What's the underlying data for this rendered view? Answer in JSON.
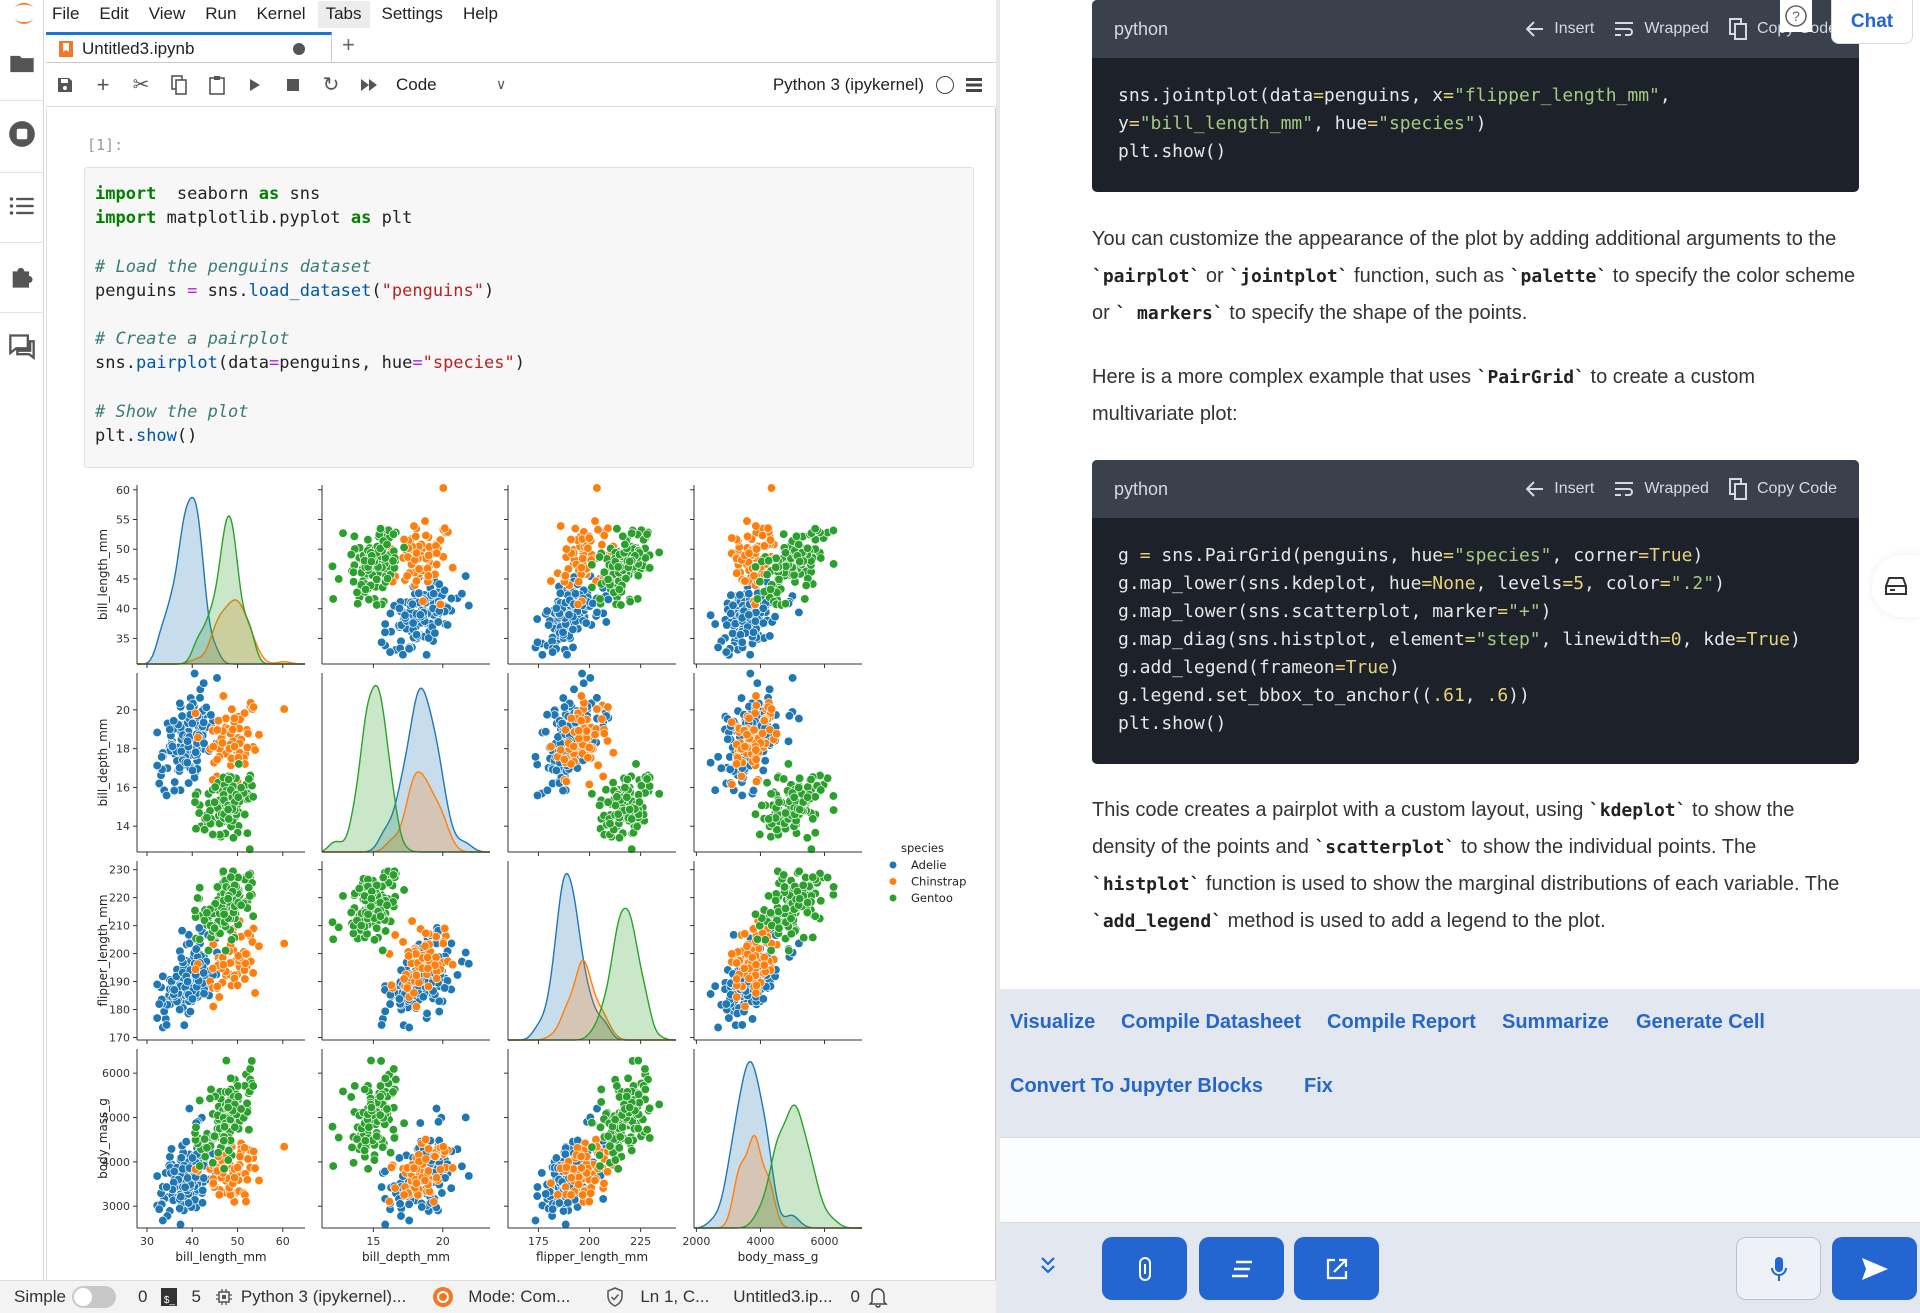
{
  "menu": [
    "File",
    "Edit",
    "View",
    "Run",
    "Kernel",
    "Tabs",
    "Settings",
    "Help"
  ],
  "menu_active": "Tabs",
  "tab": {
    "title": "Untitled3.ipynb",
    "new_tab": "+"
  },
  "toolbar": {
    "cell_type": "Code",
    "kernel": "Python 3 (ipykernel)"
  },
  "cell": {
    "prompt": "[1]:",
    "lines": [
      [
        [
          "kw",
          "import"
        ],
        [
          "",
          "  seaborn "
        ],
        [
          "kw",
          "as"
        ],
        [
          "",
          " sns"
        ]
      ],
      [
        [
          "kw",
          "import"
        ],
        [
          "",
          " matplotlib.pyplot "
        ],
        [
          "kw",
          "as"
        ],
        [
          "",
          " plt"
        ]
      ],
      [],
      [
        [
          "cm",
          "# Load the penguins dataset"
        ]
      ],
      [
        [
          "",
          "penguins "
        ],
        [
          "op",
          "="
        ],
        [
          "",
          " sns."
        ],
        [
          "fn",
          "load_dataset"
        ],
        [
          "",
          "("
        ],
        [
          "str",
          "\"penguins\""
        ],
        [
          "",
          ")"
        ]
      ],
      [],
      [
        [
          "cm",
          "# Create a pairplot"
        ]
      ],
      [
        [
          "",
          "sns."
        ],
        [
          "fn",
          "pairplot"
        ],
        [
          "",
          "(data"
        ],
        [
          "op",
          "="
        ],
        [
          "",
          "penguins, hue"
        ],
        [
          "op",
          "="
        ],
        [
          "str",
          "\"species\""
        ],
        [
          "",
          ")"
        ]
      ],
      [],
      [
        [
          "cm",
          "# Show the plot"
        ]
      ],
      [
        [
          "",
          "plt."
        ],
        [
          "fn",
          "show"
        ],
        [
          "",
          "()"
        ]
      ]
    ]
  },
  "chart_data": {
    "type": "scatter",
    "variant": "pairplot",
    "variables": [
      "bill_length_mm",
      "bill_depth_mm",
      "flipper_length_mm",
      "body_mass_g"
    ],
    "legend": {
      "title": "species",
      "placement": "right",
      "entries": [
        {
          "name": "Adelie",
          "color": "#1f77b4"
        },
        {
          "name": "Chinstrap",
          "color": "#ff7f0e"
        },
        {
          "name": "Gentoo",
          "color": "#2ca02c"
        }
      ]
    },
    "diagonal": "kde",
    "grid": false,
    "axes": [
      {
        "name": "bill_length_mm",
        "yticks": [
          "35",
          "40",
          "45",
          "50",
          "55",
          "60"
        ],
        "ytick_values": [
          35,
          40,
          45,
          50,
          55,
          60
        ],
        "xticks": [
          "30",
          "40",
          "50",
          "60"
        ],
        "xtick_values": [
          30,
          40,
          50,
          60
        ],
        "yrange": [
          30.7,
          60.8
        ],
        "xrange": [
          27.8,
          64.9
        ]
      },
      {
        "name": "bill_depth_mm",
        "yticks": [
          "14",
          "16",
          "18",
          "20"
        ],
        "ytick_values": [
          14,
          16,
          18,
          20
        ],
        "xticks": [
          "15",
          "20"
        ],
        "xtick_values": [
          15,
          20
        ],
        "yrange": [
          12.67,
          21.9
        ],
        "xrange": [
          11.3,
          23.4
        ]
      },
      {
        "name": "flipper_length_mm",
        "yticks": [
          "170",
          "180",
          "190",
          "200",
          "210",
          "220",
          "230"
        ],
        "ytick_values": [
          170,
          180,
          190,
          200,
          210,
          220,
          230
        ],
        "xticks": [
          "175",
          "200",
          "225"
        ],
        "xtick_values": [
          175,
          200,
          225
        ],
        "yrange": [
          169.1,
          233.1
        ],
        "xrange": [
          160.1,
          242.3
        ]
      },
      {
        "name": "body_mass_g",
        "yticks": [
          "3000",
          "4000",
          "5000",
          "6000"
        ],
        "ytick_values": [
          3000,
          4000,
          5000,
          6000
        ],
        "xticks": [
          "2000",
          "4000",
          "6000"
        ],
        "xtick_values": [
          2000,
          4000,
          6000
        ],
        "yrange": [
          2509,
          6545
        ],
        "xrange": [
          1925,
          7170
        ]
      }
    ]
  },
  "status": {
    "mode_label": "Simple",
    "count_a": "0",
    "count_b": "5",
    "kernel": "Python 3 (ipykernel)...",
    "mode": "Mode: Com...",
    "position": "Ln 1, C...",
    "file": "Untitled3.ip...",
    "notifications": "0"
  },
  "chat": {
    "chat_button": "Chat",
    "code_blocks": [
      {
        "lang": "python",
        "insert": "Insert",
        "wrapped": "Wrapped",
        "copy": "Copy Code",
        "lines": [
          [
            [
              "",
              "sns.jointplot(data"
            ],
            [
              "lit",
              "="
            ],
            [
              "",
              "penguins, x"
            ],
            [
              "lit",
              "="
            ],
            [
              "s2",
              "\"flipper_length_mm\""
            ],
            [
              "",
              ","
            ]
          ],
          [
            [
              "",
              "y"
            ],
            [
              "lit",
              "="
            ],
            [
              "s2",
              "\"bill_length_mm\""
            ],
            [
              "",
              ", hue"
            ],
            [
              "lit",
              "="
            ],
            [
              "s2",
              "\"species\""
            ],
            [
              "",
              ")"
            ]
          ],
          [
            [
              "",
              "plt.show()"
            ]
          ]
        ]
      },
      {
        "lang": "python",
        "insert": "Insert",
        "wrapped": "Wrapped",
        "copy": "Copy Code",
        "lines": [
          [
            [
              "",
              "g "
            ],
            [
              "lit",
              "="
            ],
            [
              "",
              " sns.PairGrid(penguins, hue"
            ],
            [
              "lit",
              "="
            ],
            [
              "s2",
              "\"species\""
            ],
            [
              "",
              ", corner"
            ],
            [
              "lit",
              "="
            ],
            [
              "lit",
              "True"
            ],
            [
              "",
              ")"
            ]
          ],
          [
            [
              "",
              "g.map_lower(sns.kdeplot, hue"
            ],
            [
              "lit",
              "="
            ],
            [
              "lit",
              "None"
            ],
            [
              "",
              ", levels"
            ],
            [
              "lit",
              "="
            ],
            [
              "lit",
              "5"
            ],
            [
              "",
              ", color"
            ],
            [
              "lit",
              "="
            ],
            [
              "s2",
              "\".2\""
            ],
            [
              "",
              ")"
            ]
          ],
          [
            [
              "",
              "g.map_lower(sns.scatterplot, marker"
            ],
            [
              "lit",
              "="
            ],
            [
              "s2",
              "\"+\""
            ],
            [
              "",
              ")"
            ]
          ],
          [
            [
              "",
              "g.map_diag(sns.histplot, element"
            ],
            [
              "lit",
              "="
            ],
            [
              "s2",
              "\"step\""
            ],
            [
              "",
              ", linewidth"
            ],
            [
              "lit",
              "="
            ],
            [
              "lit",
              "0"
            ],
            [
              "",
              ", kde"
            ],
            [
              "lit",
              "="
            ],
            [
              "lit",
              "True"
            ],
            [
              "",
              ")"
            ]
          ],
          [
            [
              "",
              "g.add_legend(frameon"
            ],
            [
              "lit",
              "="
            ],
            [
              "lit",
              "True"
            ],
            [
              "",
              ")"
            ]
          ],
          [
            [
              "",
              "g.legend.set_bbox_to_anchor(("
            ],
            [
              "lit",
              ".61"
            ],
            [
              "",
              ", "
            ],
            [
              "lit",
              ".6"
            ],
            [
              "",
              "))"
            ]
          ],
          [
            [
              "",
              "plt.show()"
            ]
          ]
        ]
      }
    ],
    "paragraphs": [
      [
        [
          "",
          "You can customize the appearance of the plot by adding additional arguments to the "
        ],
        [
          "c",
          "`pairplot`"
        ],
        [
          "",
          " or "
        ],
        [
          "c",
          "`jointplot`"
        ],
        [
          "",
          " function, such as "
        ],
        [
          "c",
          "`palette`"
        ],
        [
          "",
          " to specify the color scheme or "
        ],
        [
          "c",
          "` markers`"
        ],
        [
          "",
          " to specify the shape of the points."
        ]
      ],
      [
        [
          "",
          "Here is a more complex example that uses "
        ],
        [
          "c",
          "`PairGrid`"
        ],
        [
          "",
          " to create a custom multivariate plot:"
        ]
      ],
      [
        [
          "",
          "This code creates a pairplot with a custom layout, using "
        ],
        [
          "c",
          "`kdeplot`"
        ],
        [
          "",
          " to show the density of the points and "
        ],
        [
          "c",
          "`scatterplot`"
        ],
        [
          "",
          " to show the individual points. The "
        ],
        [
          "c",
          "`histplot`"
        ],
        [
          "",
          " function is used to show the marginal distributions of each variable. The "
        ],
        [
          "c",
          "`add_legend`"
        ],
        [
          "",
          " method is used to add a legend to the plot."
        ]
      ]
    ],
    "actions": [
      "Visualize",
      "Compile Datasheet",
      "Compile Report",
      "Summarize",
      "Generate Cell",
      "Convert To Jupyter Blocks",
      "Fix"
    ],
    "input_placeholder": "",
    "accent": "#2466d1"
  }
}
